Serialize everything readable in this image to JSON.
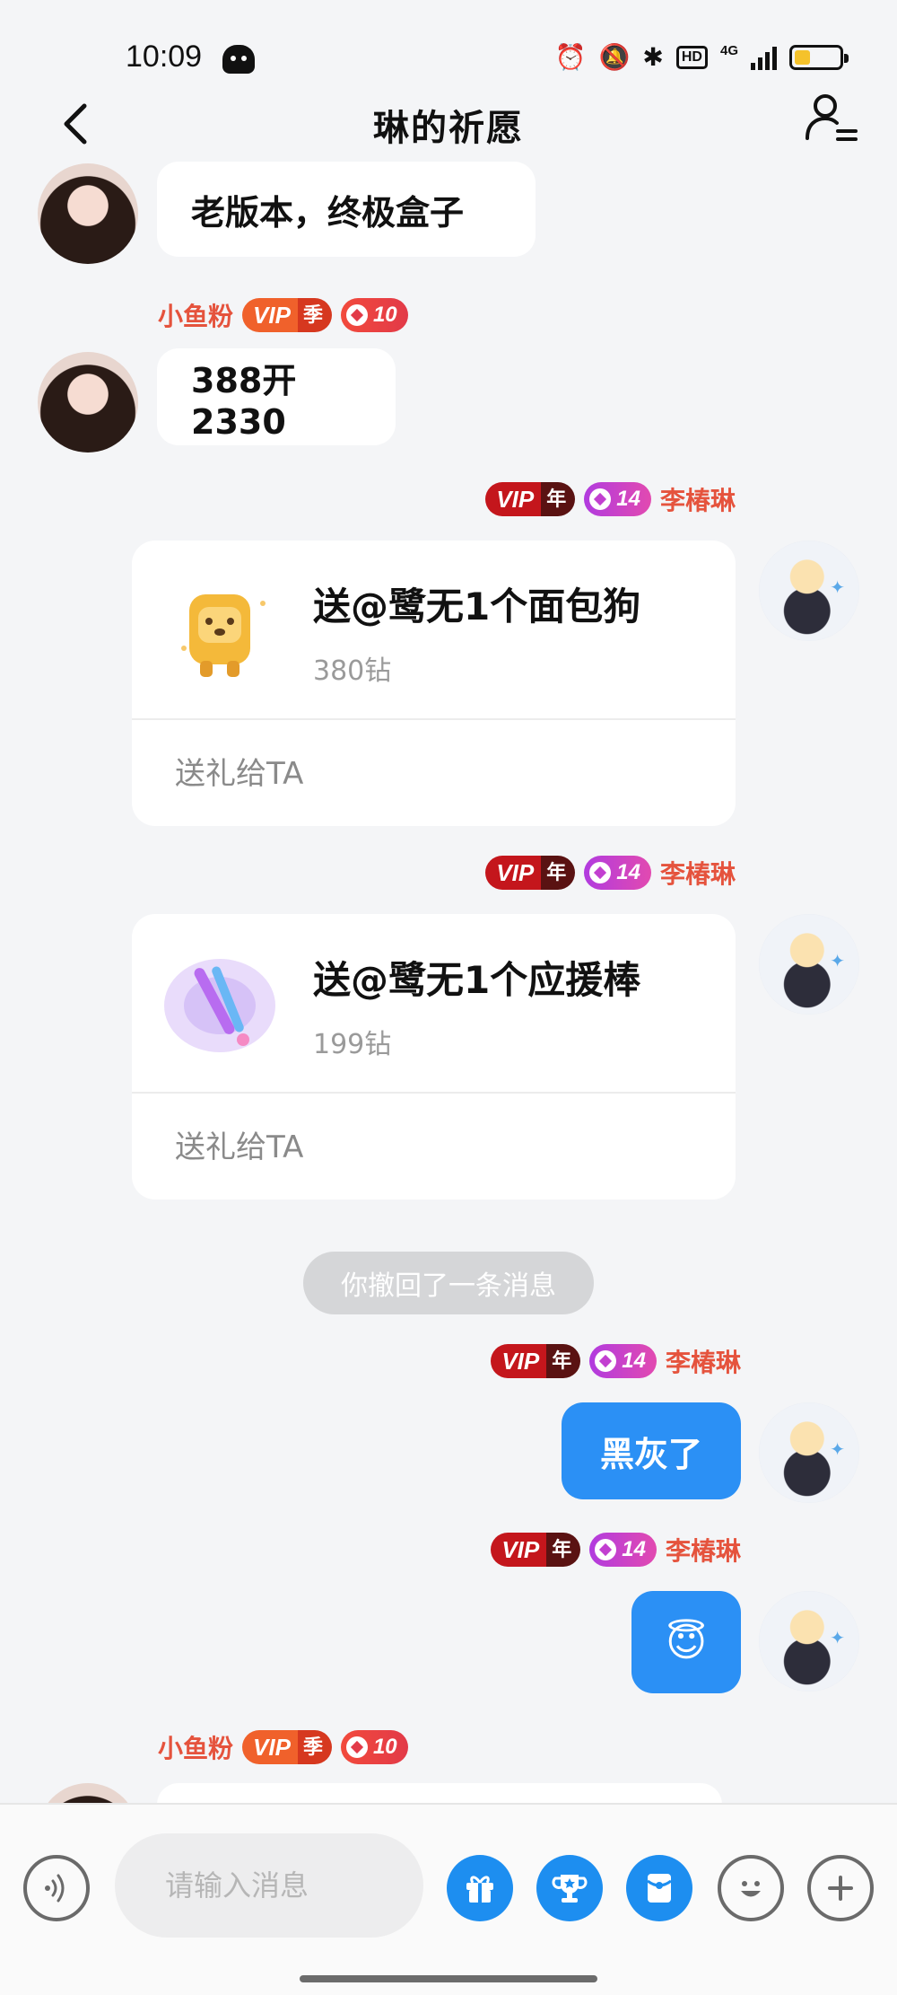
{
  "status_bar": {
    "time": "10:09",
    "hd_label": "HD",
    "network_label": "4G",
    "battery_level": 0.35,
    "icons": [
      "alarm-icon",
      "mute-icon",
      "bluetooth-icon",
      "hd-icon",
      "signal-icon",
      "battery-icon"
    ]
  },
  "header": {
    "title": "琳的祈愿",
    "back_icon": "back-arrow-icon",
    "menu_icon": "user-menu-icon"
  },
  "messages": {
    "m1": {
      "text": "老版本，终极盒子"
    },
    "m2": {
      "sender": "小鱼粉",
      "vip": "VIP",
      "vip_tier": "季",
      "level": "10",
      "text": "388开2330"
    },
    "m3": {
      "sender": "李椿琳",
      "vip": "VIP",
      "vip_tier": "年",
      "level": "14",
      "gift_title": "送@鹭无1个面包狗",
      "gift_price": "380钻",
      "action": "送礼给TA"
    },
    "m4": {
      "sender": "李椿琳",
      "vip": "VIP",
      "vip_tier": "年",
      "level": "14",
      "gift_title": "送@鹭无1个应援棒",
      "gift_price": "199钻",
      "action": "送礼给TA"
    },
    "system": {
      "text": "你撤回了一条消息"
    },
    "m5": {
      "sender": "李椿琳",
      "vip": "VIP",
      "vip_tier": "年",
      "level": "14",
      "text": "黑灰了"
    },
    "m6": {
      "sender": "李椿琳",
      "vip": "VIP",
      "vip_tier": "年",
      "level": "14",
      "text": "😇"
    },
    "m7": {
      "sender": "小鱼粉",
      "vip": "VIP",
      "vip_tier": "季",
      "level": "10"
    }
  },
  "input_bar": {
    "placeholder": "请输入消息",
    "buttons": [
      "voice-icon",
      "gift-icon",
      "trophy-icon",
      "red-packet-icon",
      "emoji-icon",
      "plus-icon"
    ]
  },
  "colors": {
    "accent_blue": "#2b90f5",
    "name_red": "#e5533d",
    "background": "#f4f5f7"
  }
}
